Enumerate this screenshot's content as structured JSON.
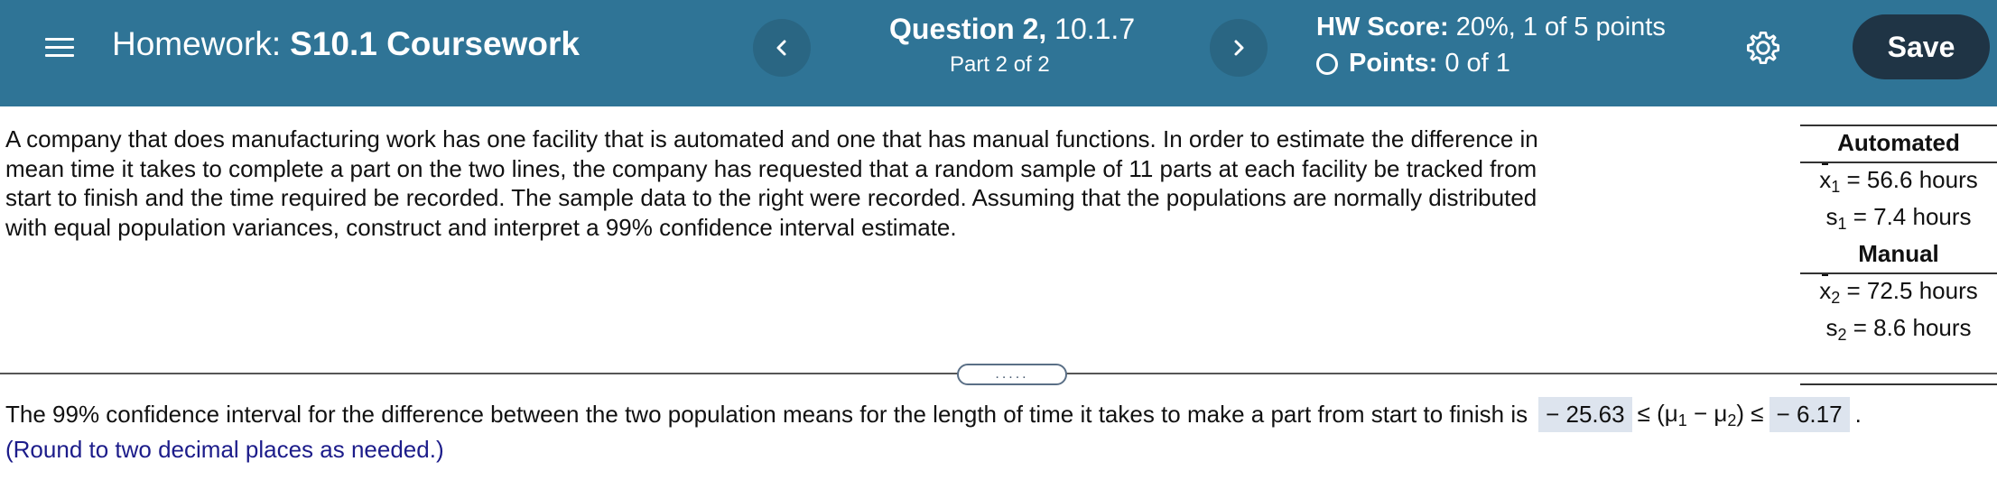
{
  "header": {
    "homework_label": "Homework:",
    "homework_name": "S10.1 Coursework",
    "question_bold": "Question 2,",
    "question_ref": "10.1.7",
    "part": "Part 2 of 2",
    "hw_score_label": "HW Score:",
    "hw_score_value": "20%, 1 of 5 points",
    "points_label": "Points:",
    "points_value": "0 of 1",
    "save_label": "Save"
  },
  "problem": {
    "text": "A company that does manufacturing work has one facility that is automated and one that has manual functions. In order to estimate the difference in mean time it takes to complete a part on the two lines, the company has requested that a random sample of 11 parts at each facility be tracked from start to finish and the time required be recorded. The sample data to the right were recorded. Assuming that the populations are normally distributed with equal population variances, construct and interpret a 99% confidence interval estimate."
  },
  "table": {
    "automated_header": "Automated",
    "x1_symbol": "x",
    "x1_sub": "1",
    "x1_value": "= 56.6 hours",
    "s1_symbol": "s",
    "s1_sub": "1",
    "s1_value": "= 7.4 hours",
    "manual_header": "Manual",
    "x2_symbol": "x",
    "x2_sub": "2",
    "x2_value": "= 72.5 hours",
    "s2_symbol": "s",
    "s2_sub": "2",
    "s2_value": "= 8.6 hours"
  },
  "divider_handle": ".....",
  "answer": {
    "prefix": "The 99% confidence interval for the difference between the two population means for the length of time it takes to make a part from start to finish is",
    "lower": "− 25.63",
    "middle": "≤ (μ",
    "mu1_sub": "1",
    "minus": " − μ",
    "mu2_sub": "2",
    "close": ") ≤",
    "upper": "− 6.17",
    "period": ".",
    "note": "(Round to two decimal places as needed.)"
  },
  "colors": {
    "header_bg": "#2f7496",
    "save_bg": "#1f3445",
    "answer_box": "#dde4ee",
    "note_text": "#1c1c8a"
  },
  "icons": [
    "menu-icon",
    "chevron-left-icon",
    "chevron-right-icon",
    "circle-icon",
    "gear-icon"
  ]
}
